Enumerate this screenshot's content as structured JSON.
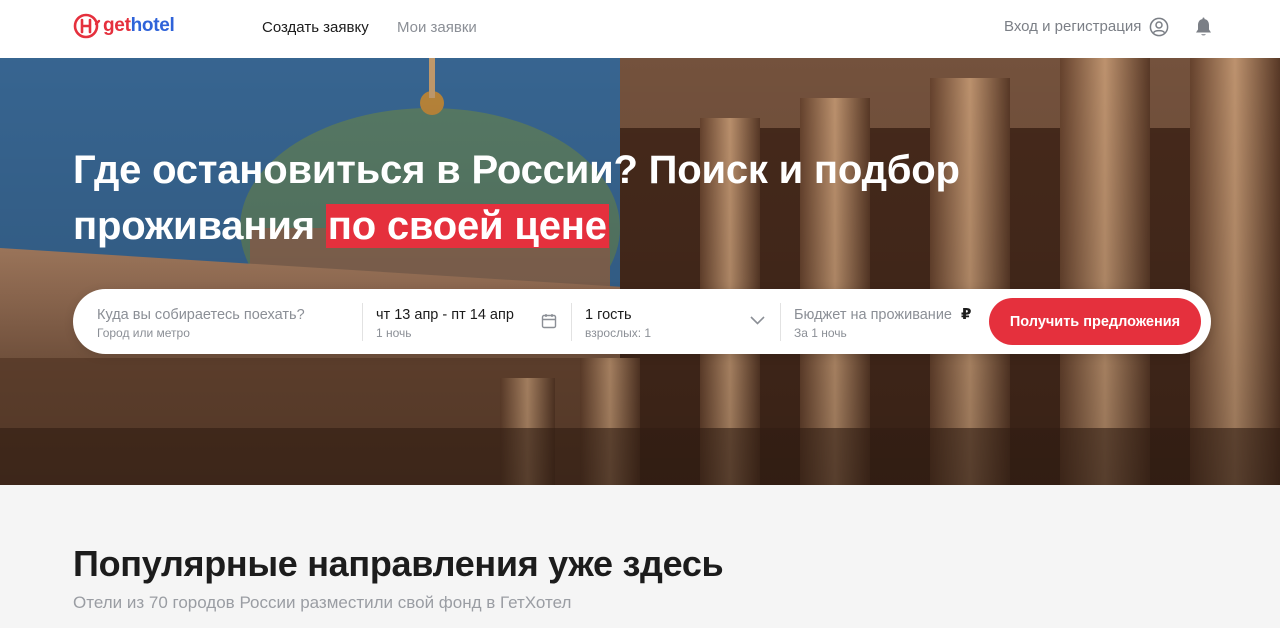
{
  "header": {
    "logo": {
      "prefix": "get",
      "suffix": "hotel"
    },
    "nav": {
      "create": "Создать заявку",
      "mine": "Мои заявки"
    },
    "login": "Вход и регистрация"
  },
  "hero": {
    "title_main": "Где остановиться в России? Поиск и подбор проживания ",
    "title_accent": "по своей цене"
  },
  "search": {
    "destination": {
      "placeholder": "Куда вы собираетесь поехать?",
      "hint": "Город или метро"
    },
    "dates": {
      "value": "чт 13 апр - пт 14 апр",
      "nights": "1 ночь"
    },
    "guests": {
      "value": "1 гость",
      "detail": "взрослых: 1"
    },
    "budget": {
      "placeholder": "Бюджет на проживание",
      "currency": "₽",
      "hint": "За 1 ночь"
    },
    "submit": "Получить предложения"
  },
  "popular": {
    "title": "Популярные направления уже здесь",
    "subtitle": "Отели из 70 городов России разместили свой фонд в ГетХотел"
  },
  "colors": {
    "accent": "#e5303d",
    "brand_blue": "#2f63d9",
    "muted": "#8b8f96"
  },
  "icons": {
    "logo": "gethotel-logo-icon",
    "user": "user-circle-icon",
    "bell": "bell-icon",
    "calendar": "calendar-icon",
    "chevron": "chevron-down-icon"
  }
}
